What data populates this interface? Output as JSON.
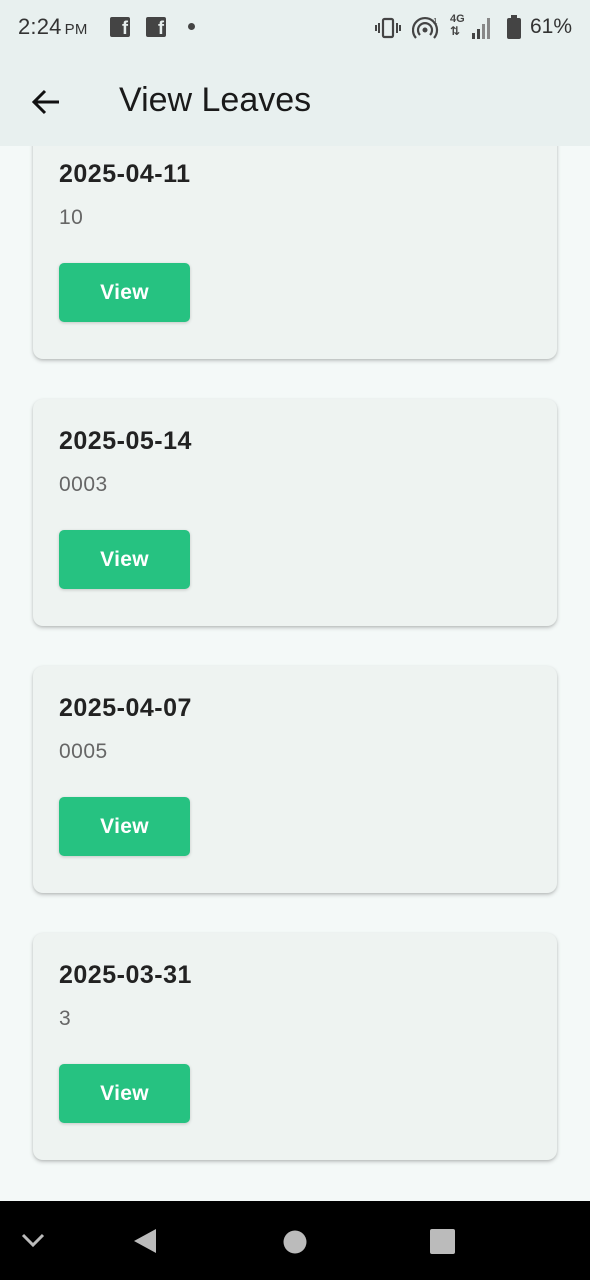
{
  "status_bar": {
    "time": "2:24",
    "ampm": "PM",
    "network": "4G",
    "battery": "61%",
    "icons": [
      "facebook-icon",
      "facebook-icon",
      "notification-dot-icon",
      "vibrate-icon",
      "hotspot-icon",
      "signal-icon",
      "battery-icon"
    ]
  },
  "app_bar": {
    "title": "View Leaves",
    "back_icon": "arrow-back-icon"
  },
  "leaves": [
    {
      "date": "2025-04-11",
      "value": "10",
      "button": "View"
    },
    {
      "date": "2025-05-14",
      "value": "0003",
      "button": "View"
    },
    {
      "date": "2025-04-07",
      "value": "0005",
      "button": "View"
    },
    {
      "date": "2025-03-31",
      "value": "3",
      "button": "View"
    }
  ],
  "colors": {
    "accent": "#26c281",
    "app_bar": "#e8f0ef",
    "card": "#eef3f1",
    "background": "#f4f9f8"
  },
  "nav_bar": {
    "icons": [
      "chevron-down-icon",
      "back-triangle-icon",
      "home-circle-icon",
      "recents-square-icon"
    ]
  }
}
